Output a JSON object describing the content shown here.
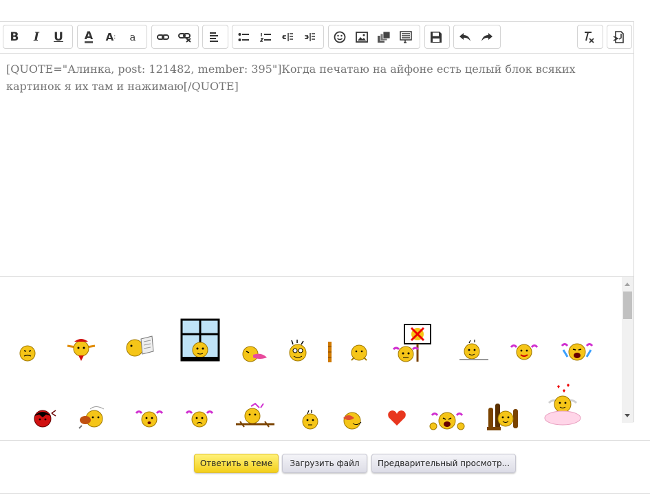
{
  "editor": {
    "text_line1": "[QUOTE=\"Алинка, post: 121482, member: 395\"]Когда печатаю на айфоне есть целый блок всяких",
    "text_line2": "картинок я их там и нажимаю[/QUOTE]"
  },
  "toolbar": {
    "bold": "B",
    "italic": "I",
    "underline": "U",
    "text_color": "A",
    "font_size": "A",
    "font_family": "a",
    "icons": [
      "bold-icon",
      "italic-icon",
      "underline-icon",
      "text-color-icon",
      "font-size-icon",
      "font-family-icon",
      "link-icon",
      "unlink-icon",
      "align-icon",
      "bullet-list-icon",
      "numbered-list-icon",
      "outdent-icon",
      "indent-icon",
      "smilie-icon",
      "image-icon",
      "media-icon",
      "quote-icon",
      "save-draft-icon",
      "undo-icon",
      "redo-icon",
      "remove-format-icon",
      "toggle-bbcode-icon"
    ]
  },
  "actions": {
    "reply": "Ответить в теме",
    "upload": "Загрузить файл",
    "preview": "Предварительный просмотр..."
  },
  "colors": {
    "primary_button": "#f7d83a",
    "secondary_button": "#e4e4ec",
    "text": "#747474"
  }
}
